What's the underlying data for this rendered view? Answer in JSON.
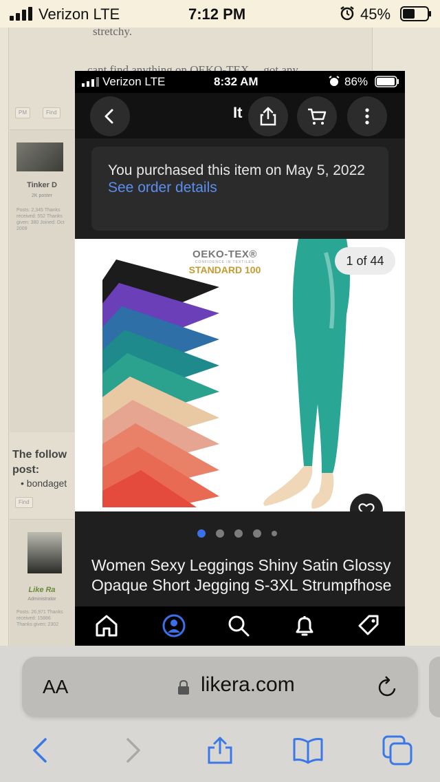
{
  "outer_status": {
    "carrier": "Verizon  LTE",
    "time": "7:12 PM",
    "battery": "45%"
  },
  "forum": {
    "snippet_top": "stretchy.",
    "snippet_2": "cant find anything on OEKO-TEX ... got any",
    "btn_pm": "PM",
    "btn_find": "Find",
    "user1": {
      "name": "Tinker D",
      "rank": "2K poster",
      "stats": "Posts: 2,345 Thanks received: 552 Thanks given: 380 Joined: Oct 2009"
    },
    "follow_label": "The follow",
    "follow_label2": "post:",
    "follow_item": "bondaget",
    "btn_find2": "Find",
    "user2": {
      "name": "Like Ra",
      "rank": "Administrator",
      "stats": "Posts: 26,971 Thanks received: 15886 Thanks given: 2302"
    }
  },
  "inner_status": {
    "carrier": "Verizon  LTE",
    "time": "8:32 AM",
    "battery": "86%"
  },
  "nav": {
    "title": "It",
    "icons": [
      "back-icon",
      "share-icon",
      "cart-icon",
      "more-icon"
    ]
  },
  "notice": {
    "text": "You purchased this item on May 5, 2022",
    "link": "See order details"
  },
  "hero": {
    "counter": "1 of 44",
    "oeko_line1": "OEKO-TEX®",
    "oeko_line2": "CONFIDENCE IN TEXTILES",
    "oeko_line3": "STANDARD 100",
    "fabric_colors": [
      "#1c1c1c",
      "#6a3fb8",
      "#2d6fa6",
      "#1e8a8c",
      "#2aa28e",
      "#e8c9a4",
      "#e5a590",
      "#e98068",
      "#e96a52",
      "#e54b3c"
    ],
    "legging_color": "#2aa695"
  },
  "carousel": {
    "count": 5,
    "active": 0,
    "accent": "#3b70e8"
  },
  "item_title": "Women Sexy Leggings Shiny Satin Glossy Opaque Short Jegging S-3XL Strumpfhose",
  "tabbar": {
    "icons": [
      "home-icon",
      "profile-icon",
      "search-icon",
      "notifications-icon",
      "selling-icon"
    ],
    "active": "profile-icon",
    "accent": "#3b70e8"
  },
  "safari": {
    "aa_label": "AA",
    "url": "likera.com"
  }
}
